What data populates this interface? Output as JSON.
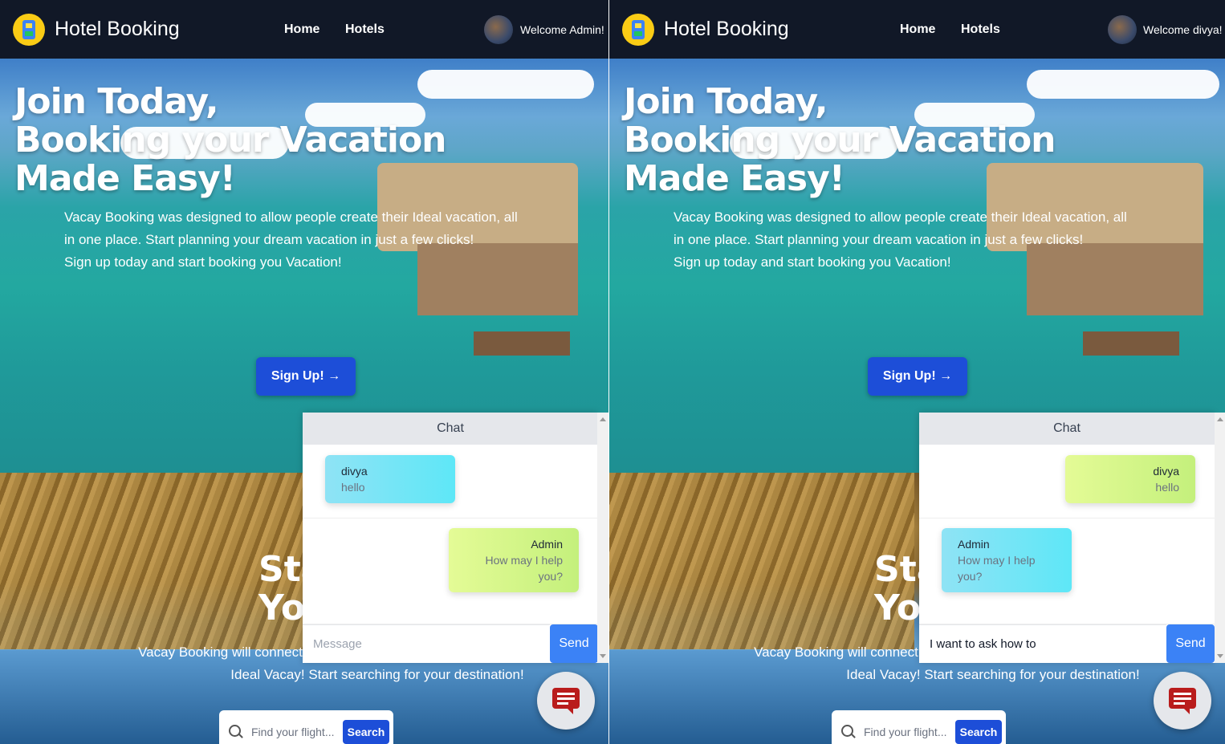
{
  "panes": {
    "left": {
      "brand": "Hotel Booking",
      "nav": [
        "Home",
        "Hotels"
      ],
      "welcome": "Welcome Admin!",
      "chat_title": "Chat",
      "messages": [
        {
          "who": "divya",
          "text": "hello",
          "side": "left",
          "color": "cyan"
        },
        {
          "who": "Admin",
          "text": "How may I help you?",
          "side": "right",
          "color": "lime"
        }
      ],
      "input_placeholder": "Message",
      "input_value": "",
      "send_label": "Send"
    },
    "right": {
      "brand": "Hotel Booking",
      "nav": [
        "Home",
        "Hotels"
      ],
      "welcome": "Welcome divya!",
      "chat_title": "Chat",
      "messages": [
        {
          "who": "divya",
          "text": "hello",
          "side": "right",
          "color": "lime"
        },
        {
          "who": "Admin",
          "text": "How may I help you?",
          "side": "left",
          "color": "cyan"
        }
      ],
      "input_placeholder": "Message",
      "input_value": "I want to ask how to",
      "send_label": "Send"
    }
  },
  "hero": {
    "title_lines": [
      "Join Today,",
      "Booking your Vacation",
      "Made Easy!"
    ],
    "text_lines": [
      "Vacay Booking was designed to allow people create their Ideal vacation, all",
      "in one place. Start planning your dream vacation in just a few clicks!",
      "Sign up today and start booking you Vacation!"
    ],
    "signup_label": "Sign Up! →"
  },
  "lower": {
    "heading_partial": [
      "Sta",
      "Yo"
    ],
    "text_lines": [
      "Vacay Booking will connect you to",
      "Ideal Vacay! Start searching for your destination!"
    ],
    "search_placeholder": "Find your flight...",
    "search_button": "Search"
  },
  "colors": {
    "nav_bg": "#111827",
    "primary": "#1d4ed8",
    "send": "#3b82f6",
    "bubble_cyan": "#5ee7f7",
    "bubble_lime": "#c4f07c",
    "fab_icon": "#b91c1c"
  }
}
